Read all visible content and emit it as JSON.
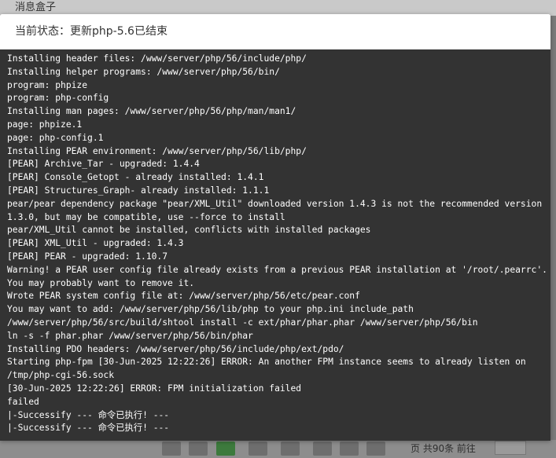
{
  "background": {
    "panel_title": "消息盒子",
    "footer_page_text": "页 共90条 前往"
  },
  "modal": {
    "status_text": "当前状态：更新php-5.6已结束"
  },
  "console": {
    "lines": [
      "Installing header files: /www/server/php/56/include/php/",
      "Installing helper programs: /www/server/php/56/bin/",
      "program: phpize",
      "program: php-config",
      "Installing man pages: /www/server/php/56/php/man/man1/",
      "page: phpize.1",
      "page: php-config.1",
      "Installing PEAR environment: /www/server/php/56/lib/php/",
      "[PEAR] Archive_Tar - upgraded: 1.4.4",
      "[PEAR] Console_Getopt - already installed: 1.4.1",
      "[PEAR] Structures_Graph- already installed: 1.1.1",
      "pear/pear dependency package \"pear/XML_Util\" downloaded version 1.4.3 is not the recommended version",
      "1.3.0, but may be compatible, use --force to install",
      "pear/XML_Util cannot be installed, conflicts with installed packages",
      "[PEAR] XML_Util - upgraded: 1.4.3",
      "[PEAR] PEAR - upgraded: 1.10.7",
      "Warning! a PEAR user config file already exists from a previous PEAR installation at '/root/.pearrc'.",
      "You may probably want to remove it.",
      "Wrote PEAR system config file at: /www/server/php/56/etc/pear.conf",
      "You may want to add: /www/server/php/56/lib/php to your php.ini include_path",
      "/www/server/php/56/src/build/shtool install -c ext/phar/phar.phar /www/server/php/56/bin",
      "ln -s -f phar.phar /www/server/php/56/bin/phar",
      "Installing PDO headers: /www/server/php/56/include/php/ext/pdo/",
      "Starting php-fpm [30-Jun-2025 12:22:26] ERROR: An another FPM instance seems to already listen on",
      "/tmp/php-cgi-56.sock",
      "[30-Jun-2025 12:22:26] ERROR: FPM initialization failed",
      "failed",
      "|-Successify --- 命令已执行! ---",
      "|-Successify --- 命令已执行! ---"
    ]
  },
  "colors": {
    "console_bg": "#333333",
    "console_text": "#ffffff",
    "overlay": "#7a7a7a"
  }
}
